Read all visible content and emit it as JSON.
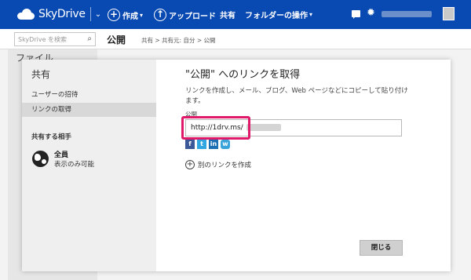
{
  "topbar": {
    "app_name": "SkyDrive",
    "create_label": "作成",
    "upload_label": "アップロード",
    "share_label": "共有",
    "folder_ops_label": "フォルダーの操作"
  },
  "background": {
    "search_placeholder": "SkyDrive を検索",
    "page_title": "公開",
    "breadcrumb": "共有 > 共有元: 自分 > 公開",
    "sidebar_peek": "ファイル"
  },
  "dialog": {
    "side_title": "共有",
    "side_items": [
      "ユーザーの招待",
      "リンクの取得"
    ],
    "share_with_heading": "共有する相手",
    "audience_name": "全員",
    "audience_desc": "表示のみ可能",
    "main_title": "\"公開\" へのリンクを取得",
    "main_desc": "リンクを作成し、メール、ブログ、Web ページなどにコピーして貼り付けます。",
    "field_label": "公開",
    "link_value": "http://1drv.ms/",
    "social": [
      "f",
      "t",
      "in",
      "w"
    ],
    "new_link_label": "別のリンクを作成",
    "close_label": "閉じる"
  },
  "colors": {
    "topbar": "#094ab2",
    "highlight": "#e0196b"
  }
}
